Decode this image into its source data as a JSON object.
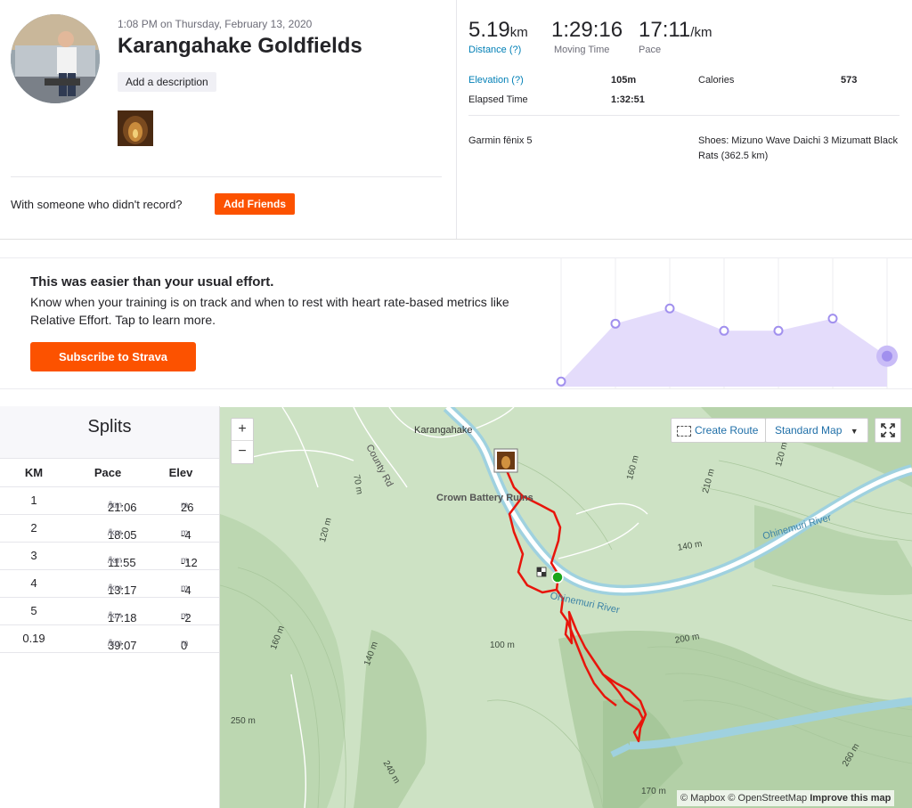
{
  "activity": {
    "datetime": "1:08 PM on Thursday, February 13, 2020",
    "title": "Karangahake Goldfields",
    "add_description": "Add a description",
    "friends_prompt": "With someone who didn't record?",
    "add_friends": "Add Friends"
  },
  "stats": {
    "distance": {
      "value": "5.19",
      "unit": "km",
      "label": "Distance (?)"
    },
    "moving_time": {
      "value": "1:29:16",
      "label": "Moving Time"
    },
    "pace": {
      "value": "17:11",
      "unit": "/km",
      "label": "Pace"
    },
    "elevation": {
      "label": "Elevation (?)",
      "value": "105m"
    },
    "calories": {
      "label": "Calories",
      "value": "573"
    },
    "elapsed": {
      "label": "Elapsed Time",
      "value": "1:32:51"
    },
    "device": "Garmin fēnix 5",
    "shoes": "Shoes: Mizuno Wave Daichi 3 Mizumatt Black Rats (362.5 km)"
  },
  "promo": {
    "title": "This was easier than your usual effort.",
    "body": "Know when your training is on track and when to rest with heart rate-based metrics like Relative Effort. Tap to learn more.",
    "button": "Subscribe to Strava"
  },
  "effort_chart": {
    "points": [
      0.05,
      0.62,
      0.77,
      0.55,
      0.55,
      0.67,
      0.3
    ],
    "highlight_index": 6
  },
  "splits": {
    "title": "Splits",
    "headers": [
      "KM",
      "Pace",
      "Elev"
    ],
    "rows": [
      {
        "km": "1",
        "pace": "21:06",
        "elev": "26"
      },
      {
        "km": "2",
        "pace": "18:05",
        "elev": "-4"
      },
      {
        "km": "3",
        "pace": "11:55",
        "elev": "-12"
      },
      {
        "km": "4",
        "pace": "13:17",
        "elev": "-4"
      },
      {
        "km": "5",
        "pace": "17:18",
        "elev": "-2"
      },
      {
        "km": "0.19",
        "pace": "39:07",
        "elev": "0"
      }
    ],
    "pace_unit": "/km",
    "elev_unit": "m"
  },
  "map": {
    "zoom_in": "+",
    "zoom_out": "−",
    "create_route": "Create Route",
    "map_type": "Standard Map",
    "labels": {
      "town": "Karangahake",
      "county_rd": "County Rd",
      "crown_battery": "Crown Battery Ruins",
      "river1": "Ohinemuri River",
      "river2": "Ohinemuri River",
      "e120": "120 m",
      "e160a": "160 m",
      "e140": "140 m",
      "e160b": "160 m",
      "e250": "250 m",
      "e240": "240 m",
      "e210": "210 m",
      "e120b": "120 m",
      "e140b": "140 m",
      "e200": "200 m",
      "e100": "100 m",
      "e170": "170 m",
      "e70": "70 m",
      "e260": "260 m"
    },
    "attribution": {
      "mapbox": "© Mapbox",
      "osm": "© OpenStreetMap",
      "improve": "Improve this map"
    }
  }
}
